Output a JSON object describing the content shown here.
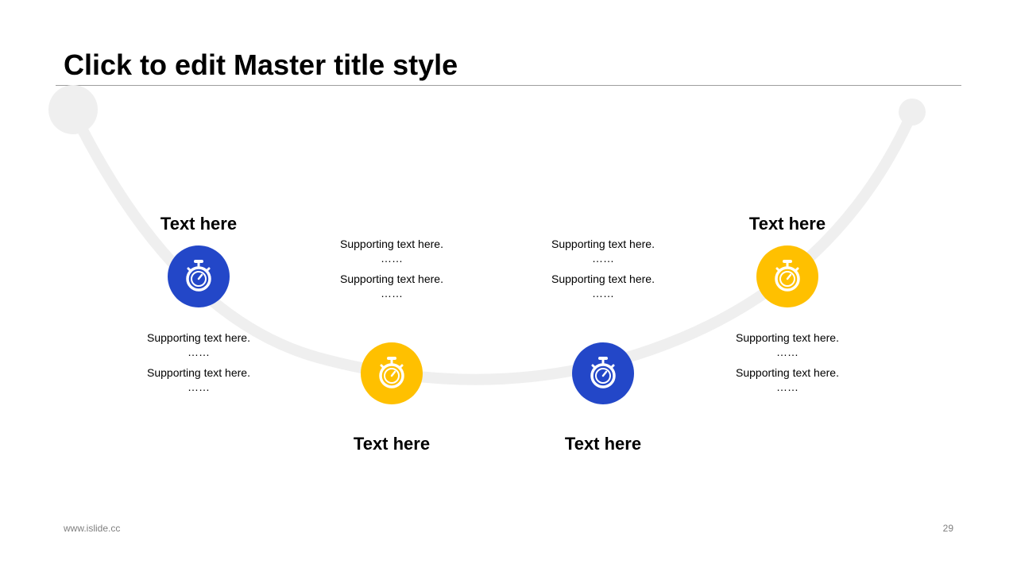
{
  "title": "Click to edit Master title style",
  "colors": {
    "blue": "#2347C8",
    "yellow": "#FFC000",
    "arc": "#EFEFEF",
    "rule": "#9E9E9E"
  },
  "steps": [
    {
      "heading": "Text here",
      "color": "blue",
      "icon": "stopwatch-icon",
      "support": [
        "Supporting text here.",
        "……",
        "Supporting text here.",
        "……"
      ]
    },
    {
      "heading": "Text here",
      "color": "yellow",
      "icon": "stopwatch-icon",
      "support": [
        "Supporting text here.",
        "……",
        "Supporting text here.",
        "……"
      ]
    },
    {
      "heading": "Text here",
      "color": "blue",
      "icon": "stopwatch-icon",
      "support": [
        "Supporting text here.",
        "……",
        "Supporting text here.",
        "……"
      ]
    },
    {
      "heading": "Text here",
      "color": "yellow",
      "icon": "stopwatch-icon",
      "support": [
        "Supporting text here.",
        "……",
        "Supporting text here.",
        "……"
      ]
    }
  ],
  "footer": {
    "url": "www.islide.cc",
    "page": "29"
  }
}
